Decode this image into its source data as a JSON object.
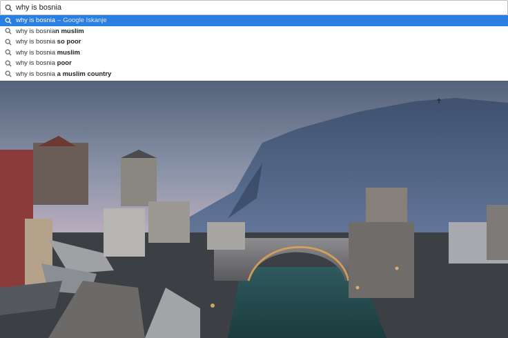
{
  "omnibox": {
    "value": "why is bosnia",
    "icon": "search-icon"
  },
  "suggestions": [
    {
      "typed": "why is bosnia",
      "completion": "",
      "engine": "Google Iskanje",
      "separator": "–",
      "selected": true
    },
    {
      "typed": "why is bosnia",
      "completion": "n muslim",
      "selected": false
    },
    {
      "typed": "why is bosnia",
      "completion": "so poor",
      "selected": false,
      "space": true
    },
    {
      "typed": "why is bosnia",
      "completion": "muslim",
      "selected": false,
      "space": true
    },
    {
      "typed": "why is bosnia",
      "completion": "poor",
      "selected": false,
      "space": true
    },
    {
      "typed": "why is bosnia",
      "completion": "a muslim country",
      "selected": false,
      "space": true
    }
  ],
  "colors": {
    "selected_row": "#2a7fe0",
    "sky_top": "#5d6a80",
    "sky_bottom": "#c9b4c1",
    "mountain": "#4e6283"
  }
}
